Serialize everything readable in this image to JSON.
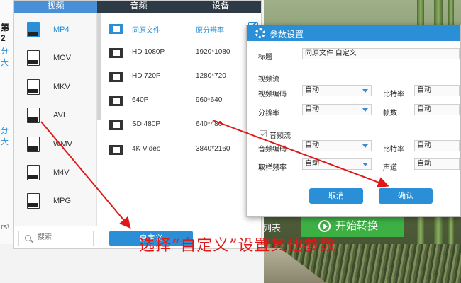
{
  "background": {
    "description_colors": [
      "#9fb089",
      "#5f6f45"
    ]
  },
  "app": {
    "strip_texts": [
      "第2",
      "分",
      "大",
      "分",
      "大",
      "rs\\"
    ]
  },
  "format_panel": {
    "tabs": [
      "视频",
      "音频",
      "设备"
    ],
    "formats": [
      {
        "label": "MP4",
        "icon": "mp4-file-icon",
        "active": true
      },
      {
        "label": "MOV",
        "icon": "mov-file-icon"
      },
      {
        "label": "MKV",
        "icon": "mkv-file-icon"
      },
      {
        "label": "AVI",
        "icon": "avi-file-icon"
      },
      {
        "label": "WMV",
        "icon": "wmv-file-icon"
      },
      {
        "label": "M4V",
        "icon": "m4v-file-icon"
      },
      {
        "label": "MPG",
        "icon": "mpg-file-icon"
      }
    ],
    "search_placeholder": "搜索",
    "presets": [
      {
        "name": "同原文件",
        "resolution": "原分辨率"
      },
      {
        "name": "HD 1080P",
        "resolution": "1920*1080"
      },
      {
        "name": "HD 720P",
        "resolution": "1280*720"
      },
      {
        "name": "640P",
        "resolution": "960*640"
      },
      {
        "name": "SD 480P",
        "resolution": "640*480"
      },
      {
        "name": "4K Video",
        "resolution": "3840*2160"
      }
    ],
    "custom_button": "自定义"
  },
  "convert": {
    "list_label": "列表",
    "start_button": "开始转换"
  },
  "dialog": {
    "title": "参数设置",
    "title_label": "标题",
    "title_value": "同原文件 自定义",
    "video_section": "视频流",
    "video_codec_label": "视频编码",
    "video_codec_value": "自动",
    "bitrate_label": "比特率",
    "bitrate_value": "自动",
    "resolution_label": "分辨率",
    "resolution_value": "自动",
    "framerate_label": "帧数",
    "framerate_value": "自动",
    "audio_section": "音频流",
    "audio_codec_label": "音频编码",
    "audio_codec_value": "自动",
    "audio_bitrate_label": "比特率",
    "audio_bitrate_value": "自动",
    "samplerate_label": "取样频率",
    "samplerate_value": "自动",
    "channel_label": "声道",
    "channel_value": "自动",
    "cancel": "取消",
    "ok": "确认"
  },
  "annotation": {
    "caption": "选择“自定义”设置其他参数",
    "color": "#e01818"
  },
  "colors": {
    "accent": "#2a8fd6",
    "start_green": "#3db044",
    "tab_bar": "#2e3a45"
  }
}
